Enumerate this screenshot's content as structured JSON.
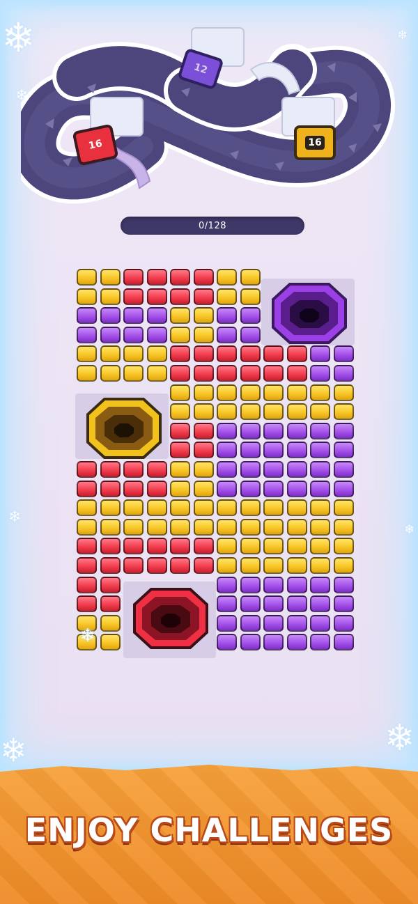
{
  "progress": {
    "current": 0,
    "total": 128,
    "label": "0/128",
    "fraction": 0
  },
  "collectors": [
    {
      "count": "16",
      "color": "#e8303e",
      "name": "red"
    },
    {
      "count": "12",
      "color": "#7b4fd8",
      "name": "purple"
    },
    {
      "count": "16",
      "color": "#f0b21c",
      "name": "yellow"
    }
  ],
  "colors": {
    "yellow": "#f8c728",
    "red": "#f23e4f",
    "purple": "#a552ea",
    "track": "#4c467d",
    "banner": "#f39830"
  },
  "board_rows": [
    "YYRRRRYY..",
    "YYRRRRYY..",
    "PPPPYYPP..",
    "PPPPYYPP..",
    "YYYYRRRRRRPP",
    "YYYYRRRRRRPP",
    "....YYYYYYYY",
    "....YYYYYYYY",
    "....RRPPPPPP",
    "....RRPPPPPP",
    "RRRRYYPPPPPP",
    "RRRRYYPPPPPP",
    "YYYYYYYYYYYY",
    "YYYYYYYYYYYY",
    "RRRRRRYYYYYY",
    "RRRRRRYYYYYY",
    "RR....PPPPPP",
    "RR....PPPPPP",
    "YY....PPPPPP",
    "YY....PPPPPP"
  ],
  "holes": [
    {
      "name": "purple",
      "color": "#9b3fe6"
    },
    {
      "name": "yellow",
      "color": "#f1c21b"
    },
    {
      "name": "red",
      "color": "#ef2f44"
    }
  ],
  "banner": {
    "text": "ENJOY CHALLENGES"
  },
  "icons": [
    "snowflake-icon",
    "arrow-icon",
    "tunnel-icon"
  ]
}
